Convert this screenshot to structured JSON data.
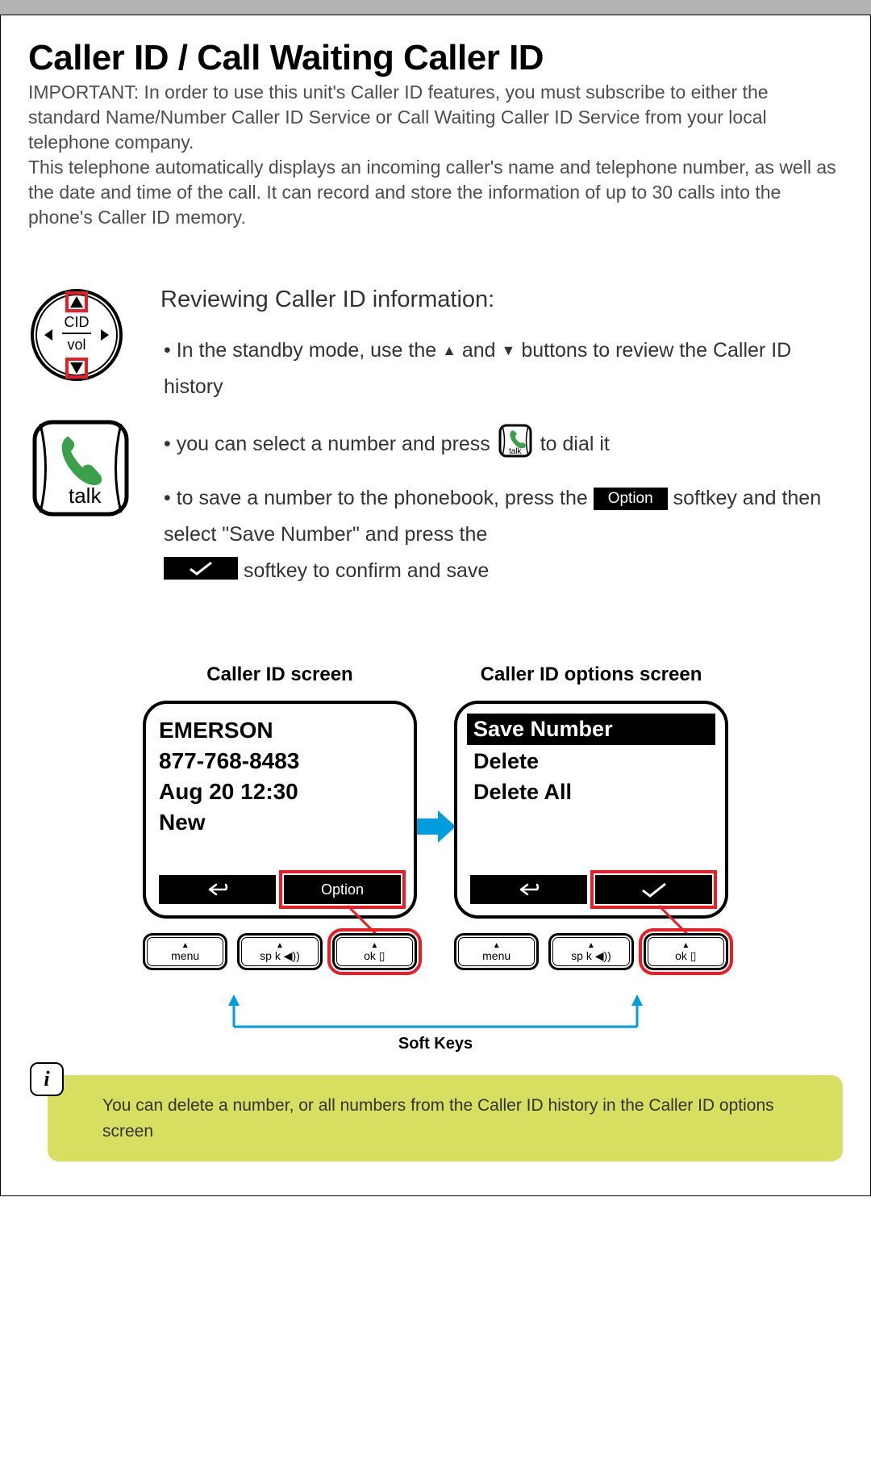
{
  "title": "Caller ID / Call Waiting Caller ID",
  "intro": "IMPORTANT: In order to use this unit's Caller ID features, you must subscribe to either the standard Name/Number Caller ID Service or Call Waiting Caller ID Service from your local telephone company.\nThis telephone automatically displays an incoming caller's name and telephone number, as well as the date and time of the call. It can record and store the information of up to 30 calls into the phone's Caller ID memory.",
  "review": {
    "heading": "Reviewing Caller ID information:",
    "b1_prefix": "• In the standby mode, use the ",
    "b1_mid": " and ",
    "b1_suffix": " buttons to review the Caller ID history",
    "b2_prefix": "• you can select a number and press ",
    "b2_suffix": " to dial it",
    "b3_prefix": "• to save a number to the phonebook, press the ",
    "b3_mid": " softkey and then select  \"Save Number\" and press the ",
    "b3_suffix": " softkey to confirm and save",
    "option_label": "Option"
  },
  "nav_pad": {
    "top_label": "CID",
    "bottom_label": "vol"
  },
  "talk_label": "talk",
  "screens": {
    "left_title": "Caller ID screen",
    "right_title": "Caller ID options screen",
    "cid": {
      "name": "EMERSON",
      "number": "877-768-8483",
      "datetime": "Aug 20  12:30",
      "status": "New",
      "sk_left": "back",
      "sk_right": "Option"
    },
    "opts": {
      "selected": "Save Number",
      "items": [
        "Delete",
        "Delete All"
      ],
      "sk_left": "back",
      "sk_right": "check"
    }
  },
  "hw_keys": {
    "menu": "menu",
    "spk": "sp k",
    "ok": "ok"
  },
  "softkeys_label": "Soft Keys",
  "tip": "You can delete a number, or all numbers from the Caller ID history in the Caller ID options screen"
}
